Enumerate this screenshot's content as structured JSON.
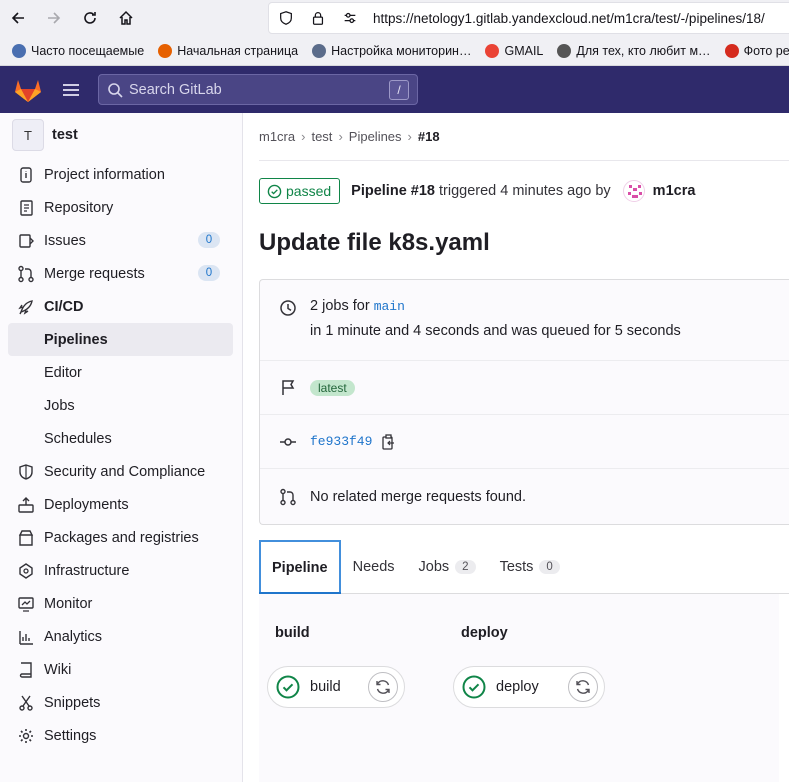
{
  "browser": {
    "url": "https://netology1.gitlab.yandexcloud.net/m1cra/test/-/pipelines/18/",
    "bookmarks": [
      {
        "label": "Часто посещаемые",
        "color": "#4a6fb0"
      },
      {
        "label": "Начальная страница",
        "color": "#e66000"
      },
      {
        "label": "Настройка мониторин…",
        "color": "#5b6c8a"
      },
      {
        "label": "GMAIL",
        "color": "#ea4335"
      },
      {
        "label": "Для тех, кто любит м…",
        "color": "#555555"
      },
      {
        "label": "Фото решения",
        "color": "#d52b1e"
      }
    ]
  },
  "header": {
    "search_placeholder": "Search GitLab",
    "search_shortcut": "/"
  },
  "sidebar": {
    "project_initial": "T",
    "project_name": "test",
    "items": [
      {
        "label": "Project information",
        "icon": "info-icon"
      },
      {
        "label": "Repository",
        "icon": "doc-icon"
      },
      {
        "label": "Issues",
        "icon": "issues-icon",
        "badge": "0"
      },
      {
        "label": "Merge requests",
        "icon": "merge-icon",
        "badge": "0"
      },
      {
        "label": "CI/CD",
        "icon": "rocket-icon"
      },
      {
        "label": "Security and Compliance",
        "icon": "shield-icon"
      },
      {
        "label": "Deployments",
        "icon": "deploy-icon"
      },
      {
        "label": "Packages and registries",
        "icon": "package-icon"
      },
      {
        "label": "Infrastructure",
        "icon": "cloud-icon"
      },
      {
        "label": "Monitor",
        "icon": "monitor-icon"
      },
      {
        "label": "Analytics",
        "icon": "chart-icon"
      },
      {
        "label": "Wiki",
        "icon": "book-icon"
      },
      {
        "label": "Snippets",
        "icon": "scissors-icon"
      },
      {
        "label": "Settings",
        "icon": "gear-icon"
      }
    ],
    "cicd_sub": [
      "Pipelines",
      "Editor",
      "Jobs",
      "Schedules"
    ]
  },
  "breadcrumb": [
    "m1cra",
    "test",
    "Pipelines",
    "#18"
  ],
  "pipeline": {
    "status": "passed",
    "title": "Pipeline #18",
    "triggered_text": "triggered 4 minutes ago by",
    "user": "m1cra",
    "commit_title": "Update file k8s.yaml",
    "jobs_count_text": "2 jobs for",
    "branch": "main",
    "duration_text": "in 1 minute and 4 seconds and was queued for 5 seconds",
    "tag": "latest",
    "sha": "fe933f49",
    "mr_text": "No related merge requests found."
  },
  "tabs": [
    {
      "label": "Pipeline"
    },
    {
      "label": "Needs"
    },
    {
      "label": "Jobs",
      "count": "2"
    },
    {
      "label": "Tests",
      "count": "0"
    }
  ],
  "graph": {
    "stages": [
      {
        "title": "build",
        "job": "build"
      },
      {
        "title": "deploy",
        "job": "deploy"
      }
    ]
  },
  "colors": {
    "gitlab_header": "#2f2a6b",
    "success": "#108548",
    "link": "#1f75cb"
  }
}
